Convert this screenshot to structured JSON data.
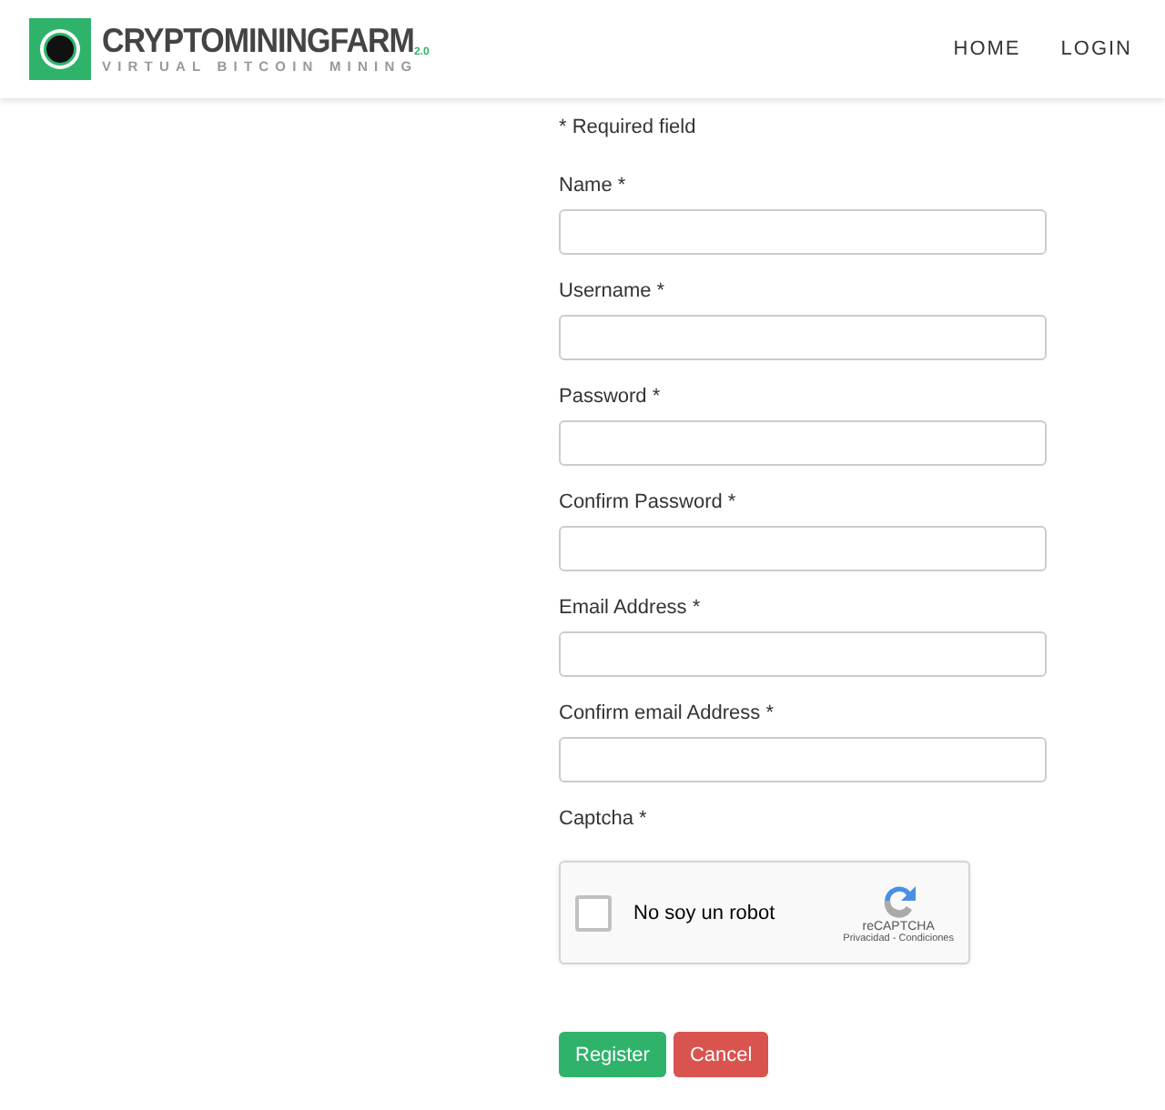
{
  "logo": {
    "title": "CRYPTOMININGFARM",
    "version": "2.0",
    "subtitle": "VIRTUAL BITCOIN MINING"
  },
  "nav": [
    {
      "label": "HOME"
    },
    {
      "label": "LOGIN"
    }
  ],
  "note": "* Required field",
  "fields": [
    {
      "label": "Name *"
    },
    {
      "label": "Username *"
    },
    {
      "label": "Password *"
    },
    {
      "label": "Confirm Password *"
    },
    {
      "label": "Email Address *"
    },
    {
      "label": "Confirm email Address *"
    }
  ],
  "captcha": {
    "label": "Captcha *",
    "checkbox_label": "No soy un robot",
    "checked": false,
    "brand": "reCAPTCHA",
    "links": "Privacidad - Condiciones"
  },
  "buttons": [
    {
      "label": "Register",
      "kind": "primary"
    },
    {
      "label": "Cancel",
      "kind": "danger"
    }
  ]
}
